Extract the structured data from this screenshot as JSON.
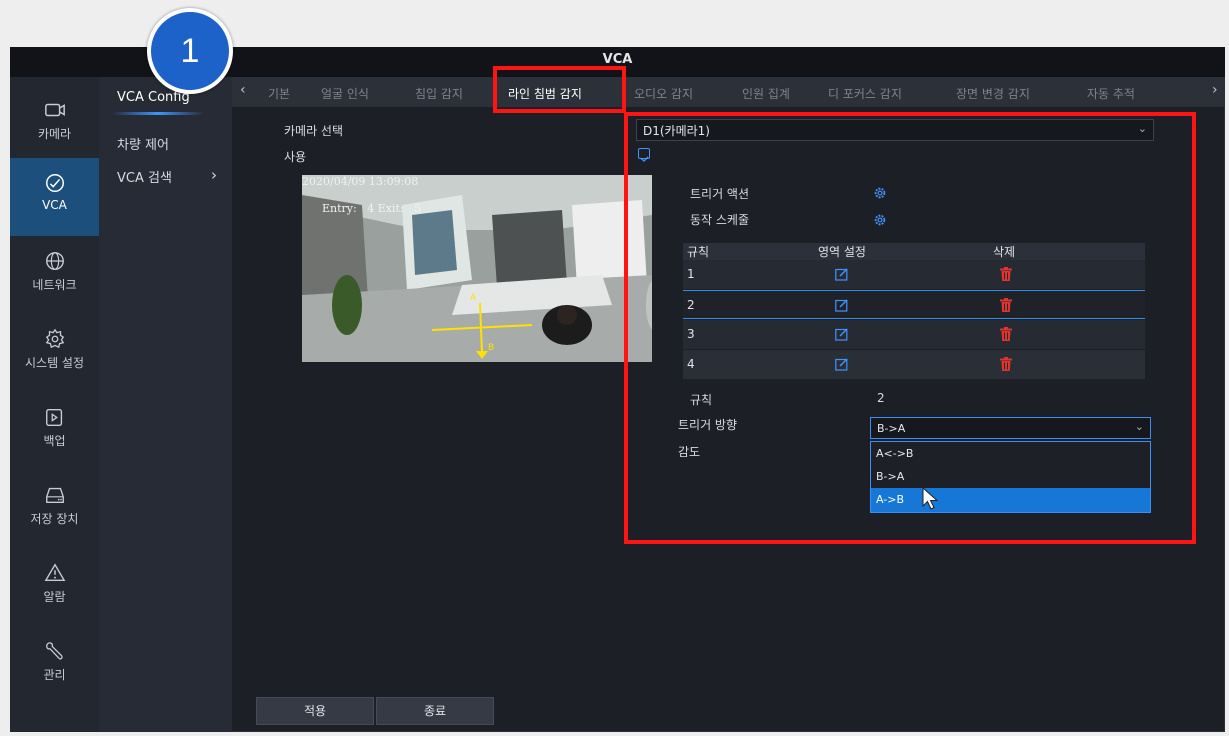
{
  "window": {
    "title": "VCA"
  },
  "badge": {
    "number": "1"
  },
  "nav": [
    {
      "label": "카메라",
      "icon": "camera-icon"
    },
    {
      "label": "VCA",
      "icon": "vca-icon",
      "active": true
    },
    {
      "label": "네트워크",
      "icon": "globe-icon"
    },
    {
      "label": "시스템 설정",
      "icon": "gear-icon"
    },
    {
      "label": "백업",
      "icon": "backup-icon"
    },
    {
      "label": "저장 장치",
      "icon": "storage-icon"
    },
    {
      "label": "알람",
      "icon": "alarm-icon"
    },
    {
      "label": "관리",
      "icon": "wrench-icon"
    }
  ],
  "submenu": [
    {
      "label": "VCA Config",
      "selected": true
    },
    {
      "label": "차량 제어"
    },
    {
      "label": "VCA 검색",
      "arrow": "›"
    }
  ],
  "tabs": {
    "prev": "‹",
    "next": "›",
    "items": [
      {
        "label": "기본"
      },
      {
        "label": "얼굴 인식"
      },
      {
        "label": "침입 감지"
      },
      {
        "label": "라인 침범 감지",
        "active": true
      },
      {
        "label": "오디오 감지"
      },
      {
        "label": "인원 집계"
      },
      {
        "label": "디 포커스 감지"
      },
      {
        "label": "장면 변경 감지"
      },
      {
        "label": "자동 추적"
      }
    ]
  },
  "form": {
    "camera_select_label": "카메라 선택",
    "camera_value": "D1(카메라1)",
    "enable_label": "사용",
    "enabled": true,
    "trigger_action_label": "트리거 액션",
    "schedule_label": "동작 스케줄",
    "rule_label": "규칙",
    "rule_value": "2",
    "direction_label": "트리거 방향",
    "direction_value": "B->A",
    "sensitivity_label": "감도"
  },
  "video": {
    "timestamp": "2020/04/09 13:09:08",
    "counter": "Entry:   4 Exit:   5",
    "point_a": "A",
    "point_b": "B"
  },
  "rules_table": {
    "headers": [
      "규칙",
      "영역 설정",
      "삭제"
    ],
    "rows": [
      "1",
      "2",
      "3",
      "4"
    ],
    "selected_row": 2
  },
  "direction_options": [
    {
      "label": "A<->B"
    },
    {
      "label": "B->A"
    },
    {
      "label": "A->B",
      "highlighted": true
    }
  ],
  "buttons": {
    "apply": "적용",
    "close": "종료"
  },
  "colors": {
    "accent": "#1677d6",
    "highlight_box": "#ff1414",
    "nav_active": "#1d4f7c",
    "delete": "#e0342f",
    "edit": "#3f95ff"
  }
}
